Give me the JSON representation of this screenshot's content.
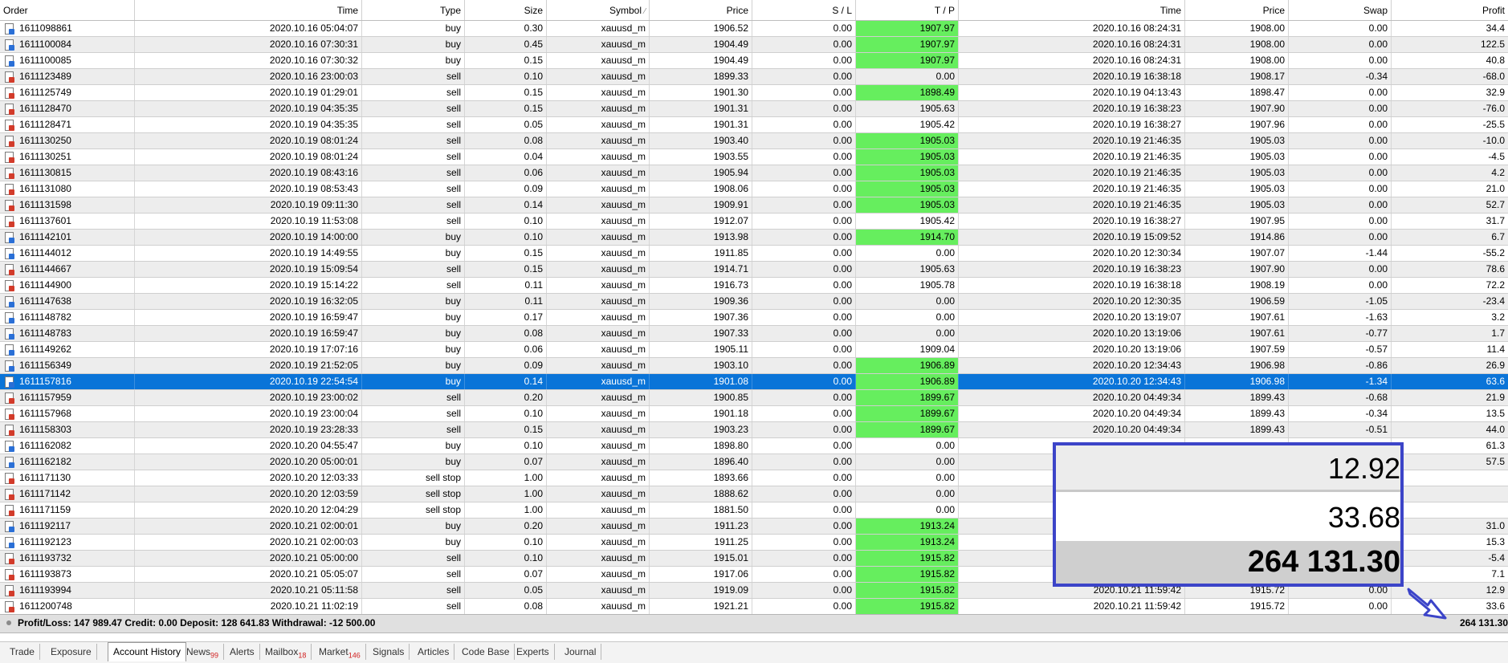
{
  "header": {
    "order": "Order",
    "time": "Time",
    "type": "Type",
    "size": "Size",
    "symbol": "Symbol",
    "price": "Price",
    "sl": "S / L",
    "tp": "T / P",
    "close_time": "Time",
    "close_price": "Price",
    "swap": "Swap",
    "profit": "Profit"
  },
  "rows": [
    {
      "order": "1611098861",
      "time": "2020.10.16 05:04:07",
      "type": "buy",
      "size": "0.30",
      "symbol": "xauusd_m",
      "price": "1906.52",
      "sl": "0.00",
      "tp": "1907.97",
      "tp_hit": true,
      "ctime": "2020.10.16 08:24:31",
      "cprice": "1908.00",
      "swap": "0.00",
      "profit": "34.4"
    },
    {
      "order": "1611100084",
      "time": "2020.10.16 07:30:31",
      "type": "buy",
      "size": "0.45",
      "symbol": "xauusd_m",
      "price": "1904.49",
      "sl": "0.00",
      "tp": "1907.97",
      "tp_hit": true,
      "ctime": "2020.10.16 08:24:31",
      "cprice": "1908.00",
      "swap": "0.00",
      "profit": "122.5"
    },
    {
      "order": "1611100085",
      "time": "2020.10.16 07:30:32",
      "type": "buy",
      "size": "0.15",
      "symbol": "xauusd_m",
      "price": "1904.49",
      "sl": "0.00",
      "tp": "1907.97",
      "tp_hit": true,
      "ctime": "2020.10.16 08:24:31",
      "cprice": "1908.00",
      "swap": "0.00",
      "profit": "40.8"
    },
    {
      "order": "1611123489",
      "time": "2020.10.16 23:00:03",
      "type": "sell",
      "size": "0.10",
      "symbol": "xauusd_m",
      "price": "1899.33",
      "sl": "0.00",
      "tp": "0.00",
      "tp_hit": false,
      "ctime": "2020.10.19 16:38:18",
      "cprice": "1908.17",
      "swap": "-0.34",
      "profit": "-68.0"
    },
    {
      "order": "1611125749",
      "time": "2020.10.19 01:29:01",
      "type": "sell",
      "size": "0.15",
      "symbol": "xauusd_m",
      "price": "1901.30",
      "sl": "0.00",
      "tp": "1898.49",
      "tp_hit": true,
      "ctime": "2020.10.19 04:13:43",
      "cprice": "1898.47",
      "swap": "0.00",
      "profit": "32.9"
    },
    {
      "order": "1611128470",
      "time": "2020.10.19 04:35:35",
      "type": "sell",
      "size": "0.15",
      "symbol": "xauusd_m",
      "price": "1901.31",
      "sl": "0.00",
      "tp": "1905.63",
      "tp_hit": false,
      "ctime": "2020.10.19 16:38:23",
      "cprice": "1907.90",
      "swap": "0.00",
      "profit": "-76.0"
    },
    {
      "order": "1611128471",
      "time": "2020.10.19 04:35:35",
      "type": "sell",
      "size": "0.05",
      "symbol": "xauusd_m",
      "price": "1901.31",
      "sl": "0.00",
      "tp": "1905.42",
      "tp_hit": false,
      "ctime": "2020.10.19 16:38:27",
      "cprice": "1907.96",
      "swap": "0.00",
      "profit": "-25.5"
    },
    {
      "order": "1611130250",
      "time": "2020.10.19 08:01:24",
      "type": "sell",
      "size": "0.08",
      "symbol": "xauusd_m",
      "price": "1903.40",
      "sl": "0.00",
      "tp": "1905.03",
      "tp_hit": true,
      "ctime": "2020.10.19 21:46:35",
      "cprice": "1905.03",
      "swap": "0.00",
      "profit": "-10.0"
    },
    {
      "order": "1611130251",
      "time": "2020.10.19 08:01:24",
      "type": "sell",
      "size": "0.04",
      "symbol": "xauusd_m",
      "price": "1903.55",
      "sl": "0.00",
      "tp": "1905.03",
      "tp_hit": true,
      "ctime": "2020.10.19 21:46:35",
      "cprice": "1905.03",
      "swap": "0.00",
      "profit": "-4.5"
    },
    {
      "order": "1611130815",
      "time": "2020.10.19 08:43:16",
      "type": "sell",
      "size": "0.06",
      "symbol": "xauusd_m",
      "price": "1905.94",
      "sl": "0.00",
      "tp": "1905.03",
      "tp_hit": true,
      "ctime": "2020.10.19 21:46:35",
      "cprice": "1905.03",
      "swap": "0.00",
      "profit": "4.2"
    },
    {
      "order": "1611131080",
      "time": "2020.10.19 08:53:43",
      "type": "sell",
      "size": "0.09",
      "symbol": "xauusd_m",
      "price": "1908.06",
      "sl": "0.00",
      "tp": "1905.03",
      "tp_hit": true,
      "ctime": "2020.10.19 21:46:35",
      "cprice": "1905.03",
      "swap": "0.00",
      "profit": "21.0"
    },
    {
      "order": "1611131598",
      "time": "2020.10.19 09:11:30",
      "type": "sell",
      "size": "0.14",
      "symbol": "xauusd_m",
      "price": "1909.91",
      "sl": "0.00",
      "tp": "1905.03",
      "tp_hit": true,
      "ctime": "2020.10.19 21:46:35",
      "cprice": "1905.03",
      "swap": "0.00",
      "profit": "52.7"
    },
    {
      "order": "1611137601",
      "time": "2020.10.19 11:53:08",
      "type": "sell",
      "size": "0.10",
      "symbol": "xauusd_m",
      "price": "1912.07",
      "sl": "0.00",
      "tp": "1905.42",
      "tp_hit": false,
      "ctime": "2020.10.19 16:38:27",
      "cprice": "1907.95",
      "swap": "0.00",
      "profit": "31.7"
    },
    {
      "order": "1611142101",
      "time": "2020.10.19 14:00:00",
      "type": "buy",
      "size": "0.10",
      "symbol": "xauusd_m",
      "price": "1913.98",
      "sl": "0.00",
      "tp": "1914.70",
      "tp_hit": true,
      "ctime": "2020.10.19 15:09:52",
      "cprice": "1914.86",
      "swap": "0.00",
      "profit": "6.7"
    },
    {
      "order": "1611144012",
      "time": "2020.10.19 14:49:55",
      "type": "buy",
      "size": "0.15",
      "symbol": "xauusd_m",
      "price": "1911.85",
      "sl": "0.00",
      "tp": "0.00",
      "tp_hit": false,
      "ctime": "2020.10.20 12:30:34",
      "cprice": "1907.07",
      "swap": "-1.44",
      "profit": "-55.2"
    },
    {
      "order": "1611144667",
      "time": "2020.10.19 15:09:54",
      "type": "sell",
      "size": "0.15",
      "symbol": "xauusd_m",
      "price": "1914.71",
      "sl": "0.00",
      "tp": "1905.63",
      "tp_hit": false,
      "ctime": "2020.10.19 16:38:23",
      "cprice": "1907.90",
      "swap": "0.00",
      "profit": "78.6"
    },
    {
      "order": "1611144900",
      "time": "2020.10.19 15:14:22",
      "type": "sell",
      "size": "0.11",
      "symbol": "xauusd_m",
      "price": "1916.73",
      "sl": "0.00",
      "tp": "1905.78",
      "tp_hit": false,
      "ctime": "2020.10.19 16:38:18",
      "cprice": "1908.19",
      "swap": "0.00",
      "profit": "72.2"
    },
    {
      "order": "1611147638",
      "time": "2020.10.19 16:32:05",
      "type": "buy",
      "size": "0.11",
      "symbol": "xauusd_m",
      "price": "1909.36",
      "sl": "0.00",
      "tp": "0.00",
      "tp_hit": false,
      "ctime": "2020.10.20 12:30:35",
      "cprice": "1906.59",
      "swap": "-1.05",
      "profit": "-23.4"
    },
    {
      "order": "1611148782",
      "time": "2020.10.19 16:59:47",
      "type": "buy",
      "size": "0.17",
      "symbol": "xauusd_m",
      "price": "1907.36",
      "sl": "0.00",
      "tp": "0.00",
      "tp_hit": false,
      "ctime": "2020.10.20 13:19:07",
      "cprice": "1907.61",
      "swap": "-1.63",
      "profit": "3.2"
    },
    {
      "order": "1611148783",
      "time": "2020.10.19 16:59:47",
      "type": "buy",
      "size": "0.08",
      "symbol": "xauusd_m",
      "price": "1907.33",
      "sl": "0.00",
      "tp": "0.00",
      "tp_hit": false,
      "ctime": "2020.10.20 13:19:06",
      "cprice": "1907.61",
      "swap": "-0.77",
      "profit": "1.7"
    },
    {
      "order": "1611149262",
      "time": "2020.10.19 17:07:16",
      "type": "buy",
      "size": "0.06",
      "symbol": "xauusd_m",
      "price": "1905.11",
      "sl": "0.00",
      "tp": "1909.04",
      "tp_hit": false,
      "ctime": "2020.10.20 13:19:06",
      "cprice": "1907.59",
      "swap": "-0.57",
      "profit": "11.4"
    },
    {
      "order": "1611156349",
      "time": "2020.10.19 21:52:05",
      "type": "buy",
      "size": "0.09",
      "symbol": "xauusd_m",
      "price": "1903.10",
      "sl": "0.00",
      "tp": "1906.89",
      "tp_hit": true,
      "ctime": "2020.10.20 12:34:43",
      "cprice": "1906.98",
      "swap": "-0.86",
      "profit": "26.9"
    },
    {
      "order": "1611157816",
      "time": "2020.10.19 22:54:54",
      "type": "buy",
      "size": "0.14",
      "symbol": "xauusd_m",
      "price": "1901.08",
      "sl": "0.00",
      "tp": "1906.89",
      "tp_hit": true,
      "ctime": "2020.10.20 12:34:43",
      "cprice": "1906.98",
      "swap": "-1.34",
      "profit": "63.6",
      "selected": true
    },
    {
      "order": "1611157959",
      "time": "2020.10.19 23:00:02",
      "type": "sell",
      "size": "0.20",
      "symbol": "xauusd_m",
      "price": "1900.85",
      "sl": "0.00",
      "tp": "1899.67",
      "tp_hit": true,
      "ctime": "2020.10.20 04:49:34",
      "cprice": "1899.43",
      "swap": "-0.68",
      "profit": "21.9"
    },
    {
      "order": "1611157968",
      "time": "2020.10.19 23:00:04",
      "type": "sell",
      "size": "0.10",
      "symbol": "xauusd_m",
      "price": "1901.18",
      "sl": "0.00",
      "tp": "1899.67",
      "tp_hit": true,
      "ctime": "2020.10.20 04:49:34",
      "cprice": "1899.43",
      "swap": "-0.34",
      "profit": "13.5"
    },
    {
      "order": "1611158303",
      "time": "2020.10.19 23:28:33",
      "type": "sell",
      "size": "0.15",
      "symbol": "xauusd_m",
      "price": "1903.23",
      "sl": "0.00",
      "tp": "1899.67",
      "tp_hit": true,
      "ctime": "2020.10.20 04:49:34",
      "cprice": "1899.43",
      "swap": "-0.51",
      "profit": "44.0"
    },
    {
      "order": "1611162082",
      "time": "2020.10.20 04:55:47",
      "type": "buy",
      "size": "0.10",
      "symbol": "xauusd_m",
      "price": "1898.80",
      "sl": "0.00",
      "tp": "0.00",
      "tp_hit": false,
      "ctime": "",
      "cprice": "",
      "swap": "",
      "profit": "61.3"
    },
    {
      "order": "1611162182",
      "time": "2020.10.20 05:00:01",
      "type": "buy",
      "size": "0.07",
      "symbol": "xauusd_m",
      "price": "1896.40",
      "sl": "0.00",
      "tp": "0.00",
      "tp_hit": false,
      "ctime": "",
      "cprice": "",
      "swap": "",
      "profit": "57.5"
    },
    {
      "order": "1611171130",
      "time": "2020.10.20 12:03:33",
      "type": "sell stop",
      "size": "1.00",
      "symbol": "xauusd_m",
      "price": "1893.66",
      "sl": "0.00",
      "tp": "0.00",
      "tp_hit": false,
      "ctime": "",
      "cprice": "",
      "swap": "",
      "profit": ""
    },
    {
      "order": "1611171142",
      "time": "2020.10.20 12:03:59",
      "type": "sell stop",
      "size": "1.00",
      "symbol": "xauusd_m",
      "price": "1888.62",
      "sl": "0.00",
      "tp": "0.00",
      "tp_hit": false,
      "ctime": "",
      "cprice": "",
      "swap": "",
      "profit": ""
    },
    {
      "order": "1611171159",
      "time": "2020.10.20 12:04:29",
      "type": "sell stop",
      "size": "1.00",
      "symbol": "xauusd_m",
      "price": "1881.50",
      "sl": "0.00",
      "tp": "0.00",
      "tp_hit": false,
      "ctime": "",
      "cprice": "",
      "swap": "",
      "profit": ""
    },
    {
      "order": "1611192117",
      "time": "2020.10.21 02:00:01",
      "type": "buy",
      "size": "0.20",
      "symbol": "xauusd_m",
      "price": "1911.23",
      "sl": "0.00",
      "tp": "1913.24",
      "tp_hit": true,
      "ctime": "",
      "cprice": "",
      "swap": "",
      "profit": "31.0"
    },
    {
      "order": "1611192123",
      "time": "2020.10.21 02:00:03",
      "type": "buy",
      "size": "0.10",
      "symbol": "xauusd_m",
      "price": "1911.25",
      "sl": "0.00",
      "tp": "1913.24",
      "tp_hit": true,
      "ctime": "",
      "cprice": "",
      "swap": "",
      "profit": "15.3"
    },
    {
      "order": "1611193732",
      "time": "2020.10.21 05:00:00",
      "type": "sell",
      "size": "0.10",
      "symbol": "xauusd_m",
      "price": "1915.01",
      "sl": "0.00",
      "tp": "1915.82",
      "tp_hit": true,
      "ctime": "",
      "cprice": "",
      "swap": "",
      "profit": "-5.4"
    },
    {
      "order": "1611193873",
      "time": "2020.10.21 05:05:07",
      "type": "sell",
      "size": "0.07",
      "symbol": "xauusd_m",
      "price": "1917.06",
      "sl": "0.00",
      "tp": "1915.82",
      "tp_hit": true,
      "ctime": "",
      "cprice": "",
      "swap": "",
      "profit": "7.1"
    },
    {
      "order": "1611193994",
      "time": "2020.10.21 05:11:58",
      "type": "sell",
      "size": "0.05",
      "symbol": "xauusd_m",
      "price": "1919.09",
      "sl": "0.00",
      "tp": "1915.82",
      "tp_hit": true,
      "ctime": "2020.10.21 11:59:42",
      "cprice": "1915.72",
      "swap": "0.00",
      "profit": "12.9"
    },
    {
      "order": "1611200748",
      "time": "2020.10.21 11:02:19",
      "type": "sell",
      "size": "0.08",
      "symbol": "xauusd_m",
      "price": "1921.21",
      "sl": "0.00",
      "tp": "1915.82",
      "tp_hit": true,
      "ctime": "2020.10.21 11:59:42",
      "cprice": "1915.72",
      "swap": "0.00",
      "profit": "33.6"
    }
  ],
  "summary": {
    "text": "Profit/Loss: 147 989.47  Credit: 0.00  Deposit: 128 641.83  Withdrawal: -12 500.00",
    "total": "264 131.30"
  },
  "zoom": {
    "line1": "12.92",
    "line2": "33.68",
    "line3": "264 131.30"
  },
  "tabs": [
    {
      "label": "Trade",
      "badge": ""
    },
    {
      "label": "Exposure",
      "badge": ""
    },
    {
      "label": "Account History",
      "badge": "",
      "active": true
    },
    {
      "label": "News",
      "badge": "99"
    },
    {
      "label": "Alerts",
      "badge": ""
    },
    {
      "label": "Mailbox",
      "badge": "18"
    },
    {
      "label": "Market",
      "badge": "146"
    },
    {
      "label": "Signals",
      "badge": ""
    },
    {
      "label": "Articles",
      "badge": ""
    },
    {
      "label": "Code Base",
      "badge": ""
    },
    {
      "label": "Experts",
      "badge": ""
    },
    {
      "label": "Journal",
      "badge": ""
    }
  ],
  "colors": {
    "tp_hit": "#66ee5e",
    "selection": "#0a74d8",
    "zoom_border": "#3c44c8"
  }
}
